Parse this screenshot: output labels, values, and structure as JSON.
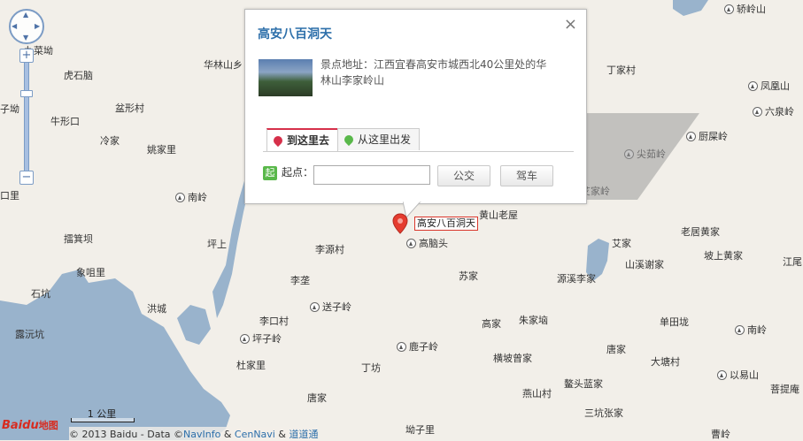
{
  "map": {
    "place_labels": [
      {
        "text": "九菜坳",
        "icon": null
      },
      {
        "text": "虎石脑",
        "icon": null
      },
      {
        "text": "子坳",
        "icon": null
      },
      {
        "text": "牛形口",
        "icon": null
      },
      {
        "text": "盆形村",
        "icon": null
      },
      {
        "text": "华林山乡",
        "icon": null
      },
      {
        "text": "冷家",
        "icon": null
      },
      {
        "text": "姚家里",
        "icon": null
      },
      {
        "text": "南岭",
        "icon": "mountain-icon"
      },
      {
        "text": "口里",
        "icon": null
      },
      {
        "text": "擂箕坝",
        "icon": null
      },
      {
        "text": "坪上",
        "icon": null
      },
      {
        "text": "象咀里",
        "icon": null
      },
      {
        "text": "李源村",
        "icon": null
      },
      {
        "text": "石坑",
        "icon": null
      },
      {
        "text": "洪城",
        "icon": null
      },
      {
        "text": "李垄",
        "icon": null
      },
      {
        "text": "送子岭",
        "icon": "mountain-icon"
      },
      {
        "text": "李口村",
        "icon": null
      },
      {
        "text": "坪子岭",
        "icon": "mountain-icon"
      },
      {
        "text": "露沅坑",
        "icon": null
      },
      {
        "text": "杜家里",
        "icon": null
      },
      {
        "text": "丁坊",
        "icon": null
      },
      {
        "text": "唐家",
        "icon": null
      },
      {
        "text": "高脑头",
        "icon": "mountain-icon"
      },
      {
        "text": "苏家",
        "icon": null
      },
      {
        "text": "高家",
        "icon": null
      },
      {
        "text": "朱家垴",
        "icon": null
      },
      {
        "text": "鹿子岭",
        "icon": "mountain-icon"
      },
      {
        "text": "横坡曾家",
        "icon": null
      },
      {
        "text": "燕山村",
        "icon": null
      },
      {
        "text": "鳌头蓝家",
        "icon": null
      },
      {
        "text": "三坑张家",
        "icon": null
      },
      {
        "text": "坳子里",
        "icon": null
      },
      {
        "text": "唐家",
        "icon": null
      },
      {
        "text": "大塘村",
        "icon": null
      },
      {
        "text": "单田垅",
        "icon": null
      },
      {
        "text": "南岭",
        "icon": "mountain-icon"
      },
      {
        "text": "以易山",
        "icon": "mountain-icon"
      },
      {
        "text": "菩提庵",
        "icon": null
      },
      {
        "text": "曹岭",
        "icon": null
      },
      {
        "text": "源溪李家",
        "icon": null
      },
      {
        "text": "山溪谢家",
        "icon": null
      },
      {
        "text": "艾家",
        "icon": null
      },
      {
        "text": "老居黄家",
        "icon": null
      },
      {
        "text": "坡上黄家",
        "icon": null
      },
      {
        "text": "江尾",
        "icon": null
      },
      {
        "text": "黄山老屋",
        "icon": null
      },
      {
        "text": "艾家岭",
        "icon": null
      },
      {
        "text": "尖茹岭",
        "icon": "mountain-icon"
      },
      {
        "text": "厨屎岭",
        "icon": "mountain-icon"
      },
      {
        "text": "丁家村",
        "icon": null
      },
      {
        "text": "凤凰山",
        "icon": "mountain-icon"
      },
      {
        "text": "六泉岭",
        "icon": "mountain-icon"
      },
      {
        "text": "轿岭山",
        "icon": "mountain-icon"
      }
    ]
  },
  "info_window": {
    "title": "高安八百洞天",
    "address_label": "景点地址：",
    "address": "江西宜春高安市城西北40公里处的华林山李家岭山",
    "tabs": [
      {
        "label": "到这里去",
        "active": true,
        "pin_color": "#d6304a"
      },
      {
        "label": "从这里出发",
        "active": false,
        "pin_color": "#59b84a"
      }
    ],
    "start_icon": "起",
    "start_label": "起点：",
    "start_value": "",
    "bus_button": "公交",
    "drive_button": "驾车",
    "close_symbol": "×"
  },
  "marker": {
    "label": "高安八百洞天",
    "color": "#e53c2f"
  },
  "scale": {
    "label": "1 公里"
  },
  "logo": {
    "brand": "Bai",
    "brand2": "du",
    "suffix": "地图"
  },
  "copyright": {
    "prefix": "© 2013 Baidu - Data ©",
    "navinfo": "NavInfo",
    "amp1": " & ",
    "cennavi": "CenNavi",
    "amp2": " & ",
    "daodaotong": "道道通"
  },
  "controls": {
    "zoom_in": "+",
    "zoom_out": "−"
  },
  "colors": {
    "water": "#99b3cc",
    "land": "#f2efe9",
    "link": "#2d6faa"
  }
}
